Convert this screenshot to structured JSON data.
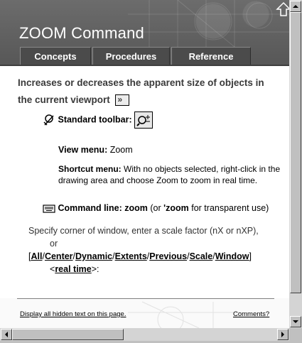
{
  "header": {
    "title": "ZOOM Command",
    "tabs": [
      {
        "label": "Concepts"
      },
      {
        "label": "Procedures"
      },
      {
        "label": "Reference"
      }
    ]
  },
  "intro": {
    "text": "Increases or decreases the apparent size of objects in the current viewport",
    "more_symbol": "»"
  },
  "toolbar": {
    "label": "Standard toolbar:"
  },
  "view_menu": {
    "label": "View menu:",
    "value": "Zoom"
  },
  "shortcut_menu": {
    "label": "Shortcut menu:",
    "text": "With no objects selected, right-click in the drawing area and choose Zoom to zoom in real time."
  },
  "command_line": {
    "label": "Command line:",
    "cmd": "zoom",
    "mid": "(or",
    "cmd2": "'zoom",
    "tail": "for transparent use)"
  },
  "prompt": {
    "line1": "Specify corner of window, enter a scale factor (nX or nXP),",
    "line2": "or",
    "open": "[",
    "options": [
      "All",
      "Center",
      "Dynamic",
      "Extents",
      "Previous",
      "Scale",
      "Window"
    ],
    "sep": "/",
    "close": "]",
    "rt_open": "<",
    "rt_label": "real time",
    "rt_close": ">:"
  },
  "footer": {
    "hidden_text_link": "Display all hidden text on this page.",
    "comments_link": "Comments?"
  },
  "colors": {
    "banner": "#5f5f5f",
    "tab": "#4b4b4b"
  }
}
